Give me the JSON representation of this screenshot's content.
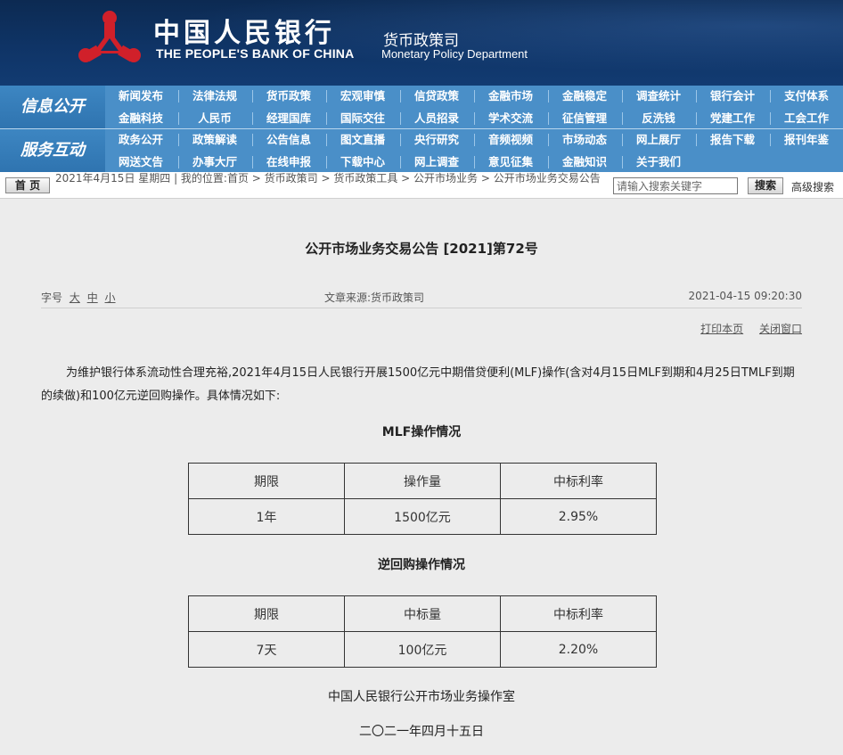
{
  "header": {
    "bank_cn": "中国人民银行",
    "bank_en": "THE PEOPLE'S BANK OF CHINA",
    "dept_cn": "货币政策司",
    "dept_en": "Monetary Policy Department"
  },
  "nav": {
    "section1_label": "信息公开",
    "section2_label": "服务互动",
    "row1": [
      "新闻发布",
      "法律法规",
      "货币政策",
      "宏观审慎",
      "信贷政策",
      "金融市场",
      "金融稳定",
      "调查统计",
      "银行会计",
      "支付体系"
    ],
    "row2": [
      "金融科技",
      "人民币",
      "经理国库",
      "国际交往",
      "人员招录",
      "学术交流",
      "征信管理",
      "反洗钱",
      "党建工作",
      "工会工作"
    ],
    "row3": [
      "政务公开",
      "政策解读",
      "公告信息",
      "图文直播",
      "央行研究",
      "音频视频",
      "市场动态",
      "网上展厅",
      "报告下载",
      "报刊年鉴"
    ],
    "row4": [
      "网送文告",
      "办事大厅",
      "在线申报",
      "下载中心",
      "网上调查",
      "意见征集",
      "金融知识",
      "关于我们"
    ]
  },
  "crumbbar": {
    "home_label": "首 页",
    "crumb_text": "2021年4月15日 星期四 | 我的位置:首页 > 货币政策司 > 货币政策工具 > 公开市场业务 > 公开市场业务交易公告",
    "search_placeholder": "请输入搜索关键字",
    "search_button": "搜索",
    "advanced_search": "高级搜索"
  },
  "article": {
    "title": "公开市场业务交易公告 [2021]第72号",
    "font_size_label": "字号",
    "font_large": "大",
    "font_medium": "中",
    "font_small": "小",
    "source": "文章来源:货币政策司",
    "datetime": "2021-04-15 09:20:30",
    "print_label": "打印本页",
    "close_label": "关闭窗口",
    "paragraph": "为维护银行体系流动性合理充裕,2021年4月15日人民银行开展1500亿元中期借贷便利(MLF)操作(含对4月15日MLF到期和4月25日TMLF到期的续做)和100亿元逆回购操作。具体情况如下:",
    "mlf_heading": "MLF操作情况",
    "mlf_table": {
      "headers": [
        "期限",
        "操作量",
        "中标利率"
      ],
      "rows": [
        [
          "1年",
          "1500亿元",
          "2.95%"
        ]
      ]
    },
    "repo_heading": "逆回购操作情况",
    "repo_table": {
      "headers": [
        "期限",
        "中标量",
        "中标利率"
      ],
      "rows": [
        [
          "7天",
          "100亿元",
          "2.20%"
        ]
      ]
    },
    "signature": "中国人民银行公开市场业务操作室",
    "sign_date": "二〇二一年四月十五日"
  }
}
